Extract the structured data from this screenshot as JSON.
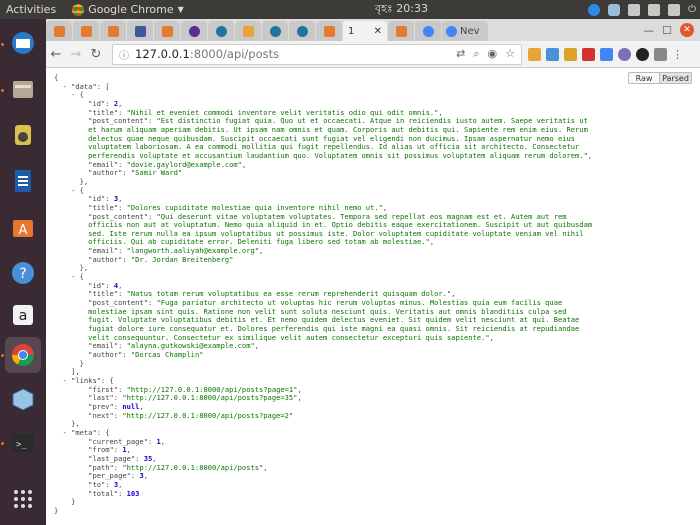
{
  "topbar": {
    "activities": "Activities",
    "app_name": "Google Chrome",
    "clock": "বৃহঃ 20:33"
  },
  "browser": {
    "active_tab_label": "1",
    "last_tab_label": "Nev",
    "url_host": "127.0.0.1",
    "url_path": ":8000/api/posts"
  },
  "viewer": {
    "raw_label": "Raw",
    "parsed_label": "Parsed"
  },
  "json": {
    "data": [
      {
        "id": "2",
        "title": "\"Nihil et eveniet commodi inventore velit veritatis odio qui odit omnis.\"",
        "post_content": "\"Est distinctio fugiat quia. Quo ut et occaecati. Atque in reiciendis iusto autem. Saepe veritatis ut et harum aliquam aperiam debitis. Ut ipsam nam omnis et quam. Corporis aut debitis qui. Sapiente rem enim eius. Rerum delectus quae neque quibusdam. Suscipit occaecati sunt fugiat vel eligendi non ducimus. Ipsam aspernatur nemo eius voluptatem laboriosam. A ea commodi mollitia qui fugit repellendus. Id alias ut officia sit architecto. Consectetur perferendis voluptate et accusantium laudantium quo. Voluptatem omnis sit possimus voluptatem aliquam rerum dolorem.\"",
        "email": "\"dovie.gaylord@example.com\"",
        "author": "\"Samir Ward\""
      },
      {
        "id": "3",
        "title": "\"Dolores cupiditate molestiae quia inventore nihil nemo ut.\"",
        "post_content": "\"Qui deserunt vitae voluptatem voluptates. Tempora sed repellat eos magnam est et. Autem aut rem officiis non aut at voluptatum. Nemo quia aliquid in et. Optio debitis eaque exercitationem. Suscipit ut aut quibusdam sed. Iste rerum nulla ea ipsum voluptatibus ut possimus iste. Dolor voluptatem cupiditate voluptate veniam vel nihil officiis. Qui ab cupiditate error. Deleniti fuga libero sed totam ab molestiae.\"",
        "email": "\"langworth.aaliyah@example.org\"",
        "author": "\"Dr. Jordan Breitenberg\""
      },
      {
        "id": "4",
        "title": "\"Natus totam rerum voluptatibus ea esse rerum reprehenderit quisquam dolor.\"",
        "post_content": "\"Fuga pariatur architecto ut voluptas hic rerum voluptas minus. Molestias quia eum facilis quae molestiae ipsam sint quis. Ratione non velit sunt soluta nesciunt quis. Veritatis aut omnis blanditiis culpa sed fugit. Voluptate voluptatibus debitis et. Et nemo quidem delectus eveniet. Sit quidem velit nesciunt at qui. Beatae fugiat dolore iure consequatur et. Dolores perferendis qui iste magni ea quasi omnis. Sit reiciendis at repudiandae velit consequuntur. Consectetur ex similique velit autem consectetur excepturi quis sapiente.\"",
        "email": "\"alayna.gutkowski@example.com\"",
        "author": "\"Dorcas Champlin\""
      }
    ],
    "links": {
      "first": "\"http://127.0.0.1:8000/api/posts?page=1\"",
      "last": "\"http://127.0.0.1:8000/api/posts?page=35\"",
      "prev": "null",
      "next": "\"http://127.0.0.1:8000/api/posts?page=2\""
    },
    "meta": {
      "current_page": "1",
      "from": "1",
      "last_page": "35",
      "path": "\"http://127.0.0.1:8000/api/posts\"",
      "per_page": "3",
      "to": "3",
      "total": "103"
    }
  },
  "colors": {
    "string": "#0b7500",
    "number": "#1a01cc",
    "launcher_bg": "#3a2a34",
    "topbar_bg": "#3c3b37"
  },
  "icons": {
    "launcher": [
      "thunderbird-icon",
      "files-icon",
      "rhythmbox-icon",
      "writer-icon",
      "software-center-icon",
      "help-icon",
      "amazon-icon",
      "chrome-icon",
      "virtualbox-icon",
      "terminal-icon",
      "app-grid-icon"
    ]
  }
}
